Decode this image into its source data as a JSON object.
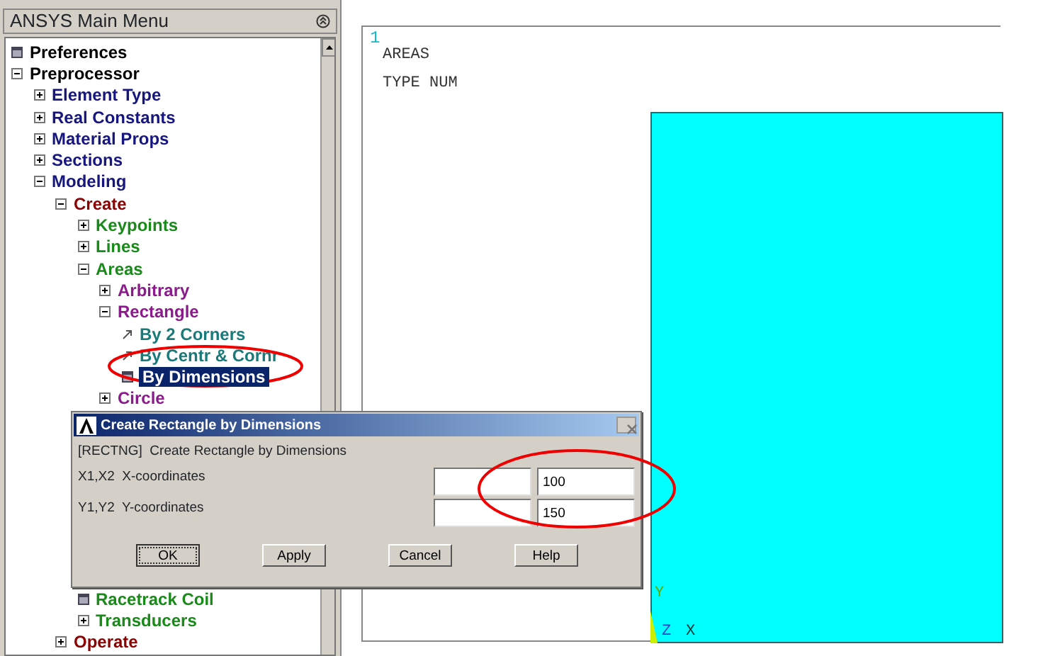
{
  "main_menu": {
    "title": "ANSYS Main Menu",
    "tree": [
      {
        "label": "Preferences",
        "kind": "dialog",
        "selected": false
      },
      {
        "label": "Preprocessor",
        "kind": "folder",
        "expanded": true,
        "selected": false,
        "children": [
          {
            "label": "Element Type",
            "kind": "folder",
            "expanded": false,
            "selected": false
          },
          {
            "label": "Real Constants",
            "kind": "folder",
            "expanded": false,
            "selected": false
          },
          {
            "label": "Material Props",
            "kind": "folder",
            "expanded": false,
            "selected": false
          },
          {
            "label": "Sections",
            "kind": "folder",
            "expanded": false,
            "selected": false
          },
          {
            "label": "Modeling",
            "kind": "folder",
            "expanded": true,
            "selected": false,
            "children": [
              {
                "label": "Create",
                "kind": "folder",
                "expanded": true,
                "selected": false,
                "children": [
                  {
                    "label": "Keypoints",
                    "kind": "folder",
                    "expanded": false,
                    "selected": false
                  },
                  {
                    "label": "Lines",
                    "kind": "folder",
                    "expanded": false,
                    "selected": false
                  },
                  {
                    "label": "Areas",
                    "kind": "folder",
                    "expanded": true,
                    "selected": false,
                    "children": [
                      {
                        "label": "Arbitrary",
                        "kind": "folder",
                        "expanded": false,
                        "selected": false
                      },
                      {
                        "label": "Rectangle",
                        "kind": "folder",
                        "expanded": true,
                        "selected": false,
                        "children": [
                          {
                            "label": "By 2 Corners",
                            "kind": "pick",
                            "selected": false
                          },
                          {
                            "label": "By Centr & Cornr",
                            "kind": "pick",
                            "selected": false
                          },
                          {
                            "label": "By Dimensions",
                            "kind": "dialog",
                            "selected": true
                          }
                        ]
                      },
                      {
                        "label": "Circle",
                        "kind": "folder",
                        "expanded": false,
                        "selected": false
                      }
                    ]
                  },
                  {
                    "label": "Racetrack Coil",
                    "kind": "dialog",
                    "selected": false,
                    "after_covered_rows": true
                  },
                  {
                    "label": "Transducers",
                    "kind": "folder",
                    "expanded": false,
                    "selected": false
                  }
                ]
              },
              {
                "label": "Operate",
                "kind": "folder",
                "expanded": false,
                "selected": false
              }
            ]
          }
        ]
      }
    ]
  },
  "graphics": {
    "window_number": "1",
    "legend": [
      "AREAS",
      "TYPE NUM"
    ],
    "triad": {
      "y": "Y",
      "z": "Z",
      "x": "X"
    }
  },
  "dialog": {
    "title": "Create Rectangle by Dimensions",
    "command": "[RECTNG]  Create Rectangle by Dimensions",
    "rows": [
      {
        "label": "X1,X2  X-coordinates",
        "value": "100"
      },
      {
        "label": "Y1,Y2  Y-coordinates",
        "value": "150"
      }
    ],
    "buttons": [
      {
        "label": "OK",
        "focused": true
      },
      {
        "label": "Apply",
        "focused": false
      },
      {
        "label": "Cancel",
        "focused": false
      },
      {
        "label": "Help",
        "focused": false
      }
    ]
  }
}
